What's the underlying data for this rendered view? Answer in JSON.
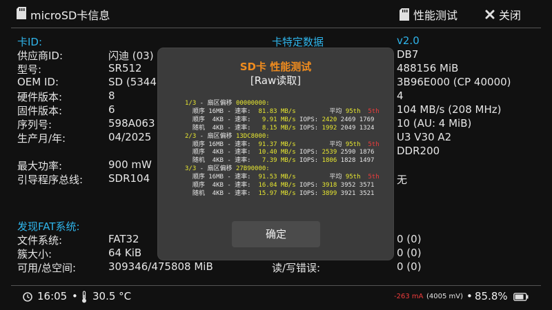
{
  "header": {
    "title": "microSD卡信息",
    "perf_label": "性能测试",
    "close_label": "关闭"
  },
  "left": {
    "section_card_id": "卡ID:",
    "rows": [
      {
        "label": "供应商ID:",
        "value": "闪迪 (03)"
      },
      {
        "label": "型号:",
        "value": "SR512"
      },
      {
        "label": "OEM ID:",
        "value": "SD (5344"
      },
      {
        "label": "硬件版本:",
        "value": "8"
      },
      {
        "label": "固件版本:",
        "value": "6"
      },
      {
        "label": "序列号:",
        "value": "598A063"
      },
      {
        "label": "生产月/年:",
        "value": "04/2025"
      },
      {
        "label": "最大功率:",
        "value": "900 mW"
      },
      {
        "label": "引导程序总线:",
        "value": "SDR104"
      }
    ],
    "section_fat": "发现FAT系统:",
    "fat_rows": [
      {
        "label": "文件系统:",
        "value": "FAT32"
      },
      {
        "label": "簇大小:",
        "value": "64 KiB"
      },
      {
        "label": "可用/总空间:",
        "value": "309346/475808 MiB"
      }
    ]
  },
  "right": {
    "section_title": "卡特定数据",
    "version": "v2.0",
    "values": [
      "DB7",
      "488156 MiB",
      "3B96E000 (CP 40000)",
      "4",
      "104 MB/s (208 MHz)",
      "10 (AU: 4 MiB)",
      "U3 V30 A2",
      "DDR200",
      "无"
    ],
    "err_label": "读/写错误:",
    "bottom_values": [
      "0 (0)",
      "0 (0)",
      "0 (0)"
    ]
  },
  "dialog": {
    "title": "SD卡 性能测试",
    "subtitle": "[Raw读取]",
    "passes": [
      {
        "head": "1/3 - 扇区偏移 00000000:",
        "rows": [
          {
            "mode": "顺序",
            "block": "16MB",
            "speed": "81.83",
            "iops": "",
            "a": "平均",
            "b": "95th",
            "c": "5th"
          },
          {
            "mode": "顺序",
            "block": "4KB",
            "speed": "9.91",
            "iops": "IOPS:",
            "a": "2420",
            "b": "2469",
            "c": "1769"
          },
          {
            "mode": "随机",
            "block": "4KB",
            "speed": "8.15",
            "iops": "IOPS:",
            "a": "1992",
            "b": "2049",
            "c": "1324"
          }
        ]
      },
      {
        "head": "2/3 - 扇区偏移 13DC8000:",
        "rows": [
          {
            "mode": "顺序",
            "block": "16MB",
            "speed": "91.37",
            "iops": "",
            "a": "平均",
            "b": "95th",
            "c": "5th"
          },
          {
            "mode": "顺序",
            "block": "4KB",
            "speed": "10.40",
            "iops": "IOPS:",
            "a": "2539",
            "b": "2590",
            "c": "1876"
          },
          {
            "mode": "随机",
            "block": "4KB",
            "speed": "7.39",
            "iops": "IOPS:",
            "a": "1806",
            "b": "1828",
            "c": "1497"
          }
        ]
      },
      {
        "head": "3/3 - 扇区偏移 27B90000:",
        "rows": [
          {
            "mode": "顺序",
            "block": "16MB",
            "speed": "91.53",
            "iops": "",
            "a": "平均",
            "b": "95th",
            "c": "5th"
          },
          {
            "mode": "顺序",
            "block": "4KB",
            "speed": "16.04",
            "iops": "IOPS:",
            "a": "3918",
            "b": "3952",
            "c": "3571"
          },
          {
            "mode": "随机",
            "block": "4KB",
            "speed": "15.97",
            "iops": "IOPS:",
            "a": "3899",
            "b": "3921",
            "c": "3521"
          }
        ]
      }
    ],
    "speed_label": "速率:",
    "unit": "MB/s",
    "ok_label": "确定"
  },
  "footer": {
    "time": "16:05",
    "sep": "•",
    "temperature": "30.5 °C",
    "current": "-263 mA",
    "voltage": "(4005 mV)",
    "battery": "85.8%",
    "battery_level": 0.858
  },
  "colors": {
    "accent_cyan": "#2fb4ea",
    "accent_yellow": "#e8e830",
    "accent_orange": "#f08c1e",
    "accent_red": "#f03c3c"
  }
}
